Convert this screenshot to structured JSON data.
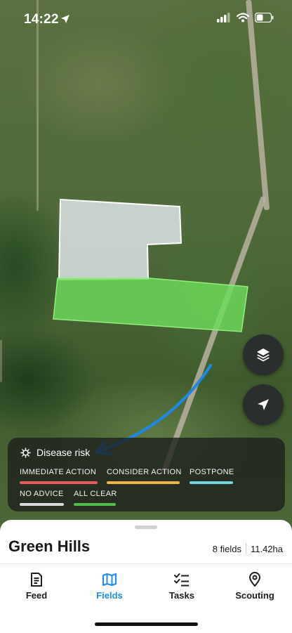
{
  "status_bar": {
    "time": "14:22",
    "icons": [
      "location-arrow-icon",
      "cellular-signal-icon",
      "wifi-icon",
      "battery-icon"
    ]
  },
  "map": {
    "controls": [
      "layers-icon",
      "locate-icon"
    ]
  },
  "legend": {
    "title": "Disease risk",
    "icon": "virus-icon",
    "items": [
      {
        "label": "IMMEDIATE ACTION",
        "color": "#e85a5a"
      },
      {
        "label": "CONSIDER ACTION",
        "color": "#f0b04a"
      },
      {
        "label": "POSTPONE",
        "color": "#6fd6dc"
      },
      {
        "label": "NO ADVICE",
        "color": "#d9d9d9"
      },
      {
        "label": "ALL CLEAR",
        "color": "#4fbe4a"
      }
    ]
  },
  "field_sheet": {
    "name": "Green Hills",
    "fields_count": "8 fields",
    "area": "11.42ha"
  },
  "tabs": [
    {
      "label": "Feed",
      "icon": "feed-icon",
      "active": false
    },
    {
      "label": "Fields",
      "icon": "map-icon",
      "active": true
    },
    {
      "label": "Tasks",
      "icon": "tasks-icon",
      "active": false
    },
    {
      "label": "Scouting",
      "icon": "pin-icon",
      "active": false
    }
  ],
  "colors": {
    "accent": "#1d8cf0",
    "arrow": "#1e88e5",
    "field_gray": "#d8e0e0",
    "field_green": "#6edc5a"
  }
}
